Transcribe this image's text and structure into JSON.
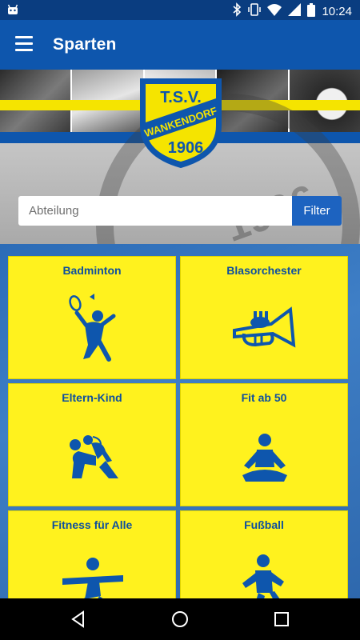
{
  "status_bar": {
    "time": "10:24",
    "icons": [
      "android-debug-icon",
      "bluetooth-icon",
      "vibrate-icon",
      "wifi-icon",
      "signal-icon",
      "battery-icon"
    ]
  },
  "app_bar": {
    "title": "Sparten",
    "menu_icon": "hamburger-menu-icon"
  },
  "header": {
    "logo_top_text": "T.S.V.",
    "logo_middle_text": "WANKENDORF",
    "logo_year": "1906"
  },
  "search": {
    "placeholder": "Abteilung",
    "value": "",
    "button_label": "Filter"
  },
  "tiles": [
    {
      "label": "Badminton",
      "icon": "badminton-icon"
    },
    {
      "label": "Blasorchester",
      "icon": "trumpet-icon"
    },
    {
      "label": "Eltern-Kind",
      "icon": "parent-child-icon"
    },
    {
      "label": "Fit ab 50",
      "icon": "yoga-icon"
    },
    {
      "label": "Fitness für Alle",
      "icon": "fitness-icon"
    },
    {
      "label": "Fußball",
      "icon": "football-icon"
    }
  ],
  "colors": {
    "primary": "#0e56ad",
    "status_bar": "#0a3d80",
    "tile_yellow": "#fff21e",
    "tile_text": "#0e4f9e",
    "button": "#1d63c0"
  },
  "nav_bar": {
    "icons": [
      "back-icon",
      "home-icon",
      "recents-icon"
    ]
  }
}
